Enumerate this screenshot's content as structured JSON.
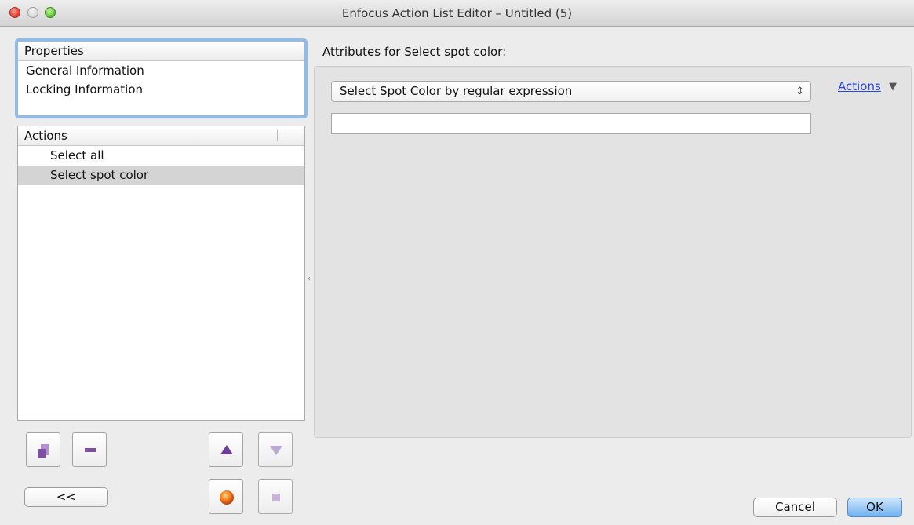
{
  "window": {
    "title": "Enfocus Action List Editor – Untitled (5)"
  },
  "properties": {
    "header": "Properties",
    "items": [
      "General Information",
      "Locking Information"
    ]
  },
  "actions_panel": {
    "header": "Actions",
    "items": [
      {
        "label": "Select all",
        "selected": false
      },
      {
        "label": "Select spot color",
        "selected": true
      }
    ]
  },
  "attributes": {
    "label": "Attributes for Select spot color:",
    "select_value": "Select Spot Color by regular expression",
    "text_value": "",
    "actions_link": "Actions"
  },
  "buttons": {
    "collapse": "<<",
    "cancel": "Cancel",
    "ok": "OK"
  },
  "colors": {
    "accent": "#6fb1f0",
    "selection": "#d4d4d4",
    "icon_purple": "#7d4fa0",
    "record_orange": "#f07a1a",
    "link": "#2a46d9"
  },
  "icons": {
    "add_action": "add-action-icon",
    "remove_action": "remove-action-icon",
    "move_up": "move-up-icon",
    "move_down": "move-down-icon",
    "record": "record-icon",
    "stop": "stop-icon"
  }
}
